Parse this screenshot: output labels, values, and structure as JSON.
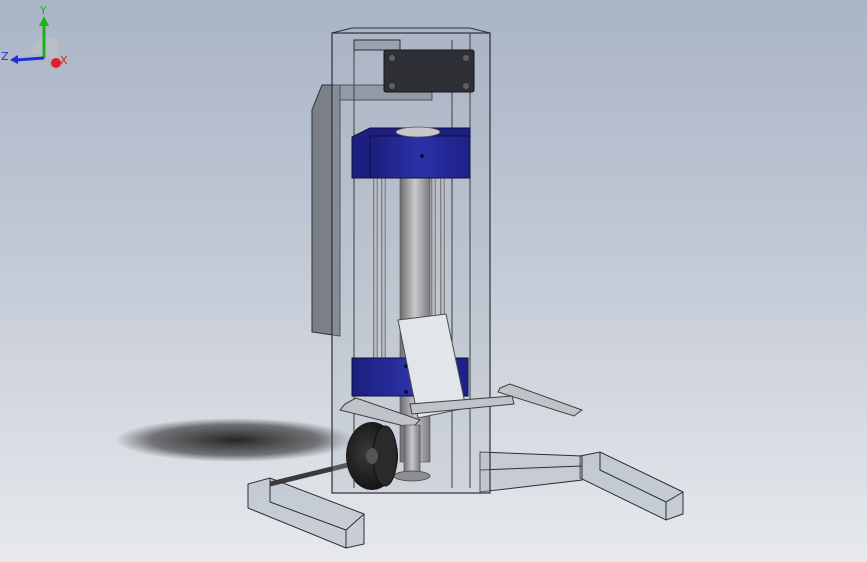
{
  "viewport": {
    "background_top": "#a9b4c6",
    "background_bottom": "#e7e9ec",
    "model": "lift-stand-assembly"
  },
  "triad": {
    "x_label": "X",
    "y_label": "Y",
    "z_label": "Z",
    "x_color": "#e32020",
    "y_color": "#19b419",
    "z_color": "#1a2fd6"
  }
}
